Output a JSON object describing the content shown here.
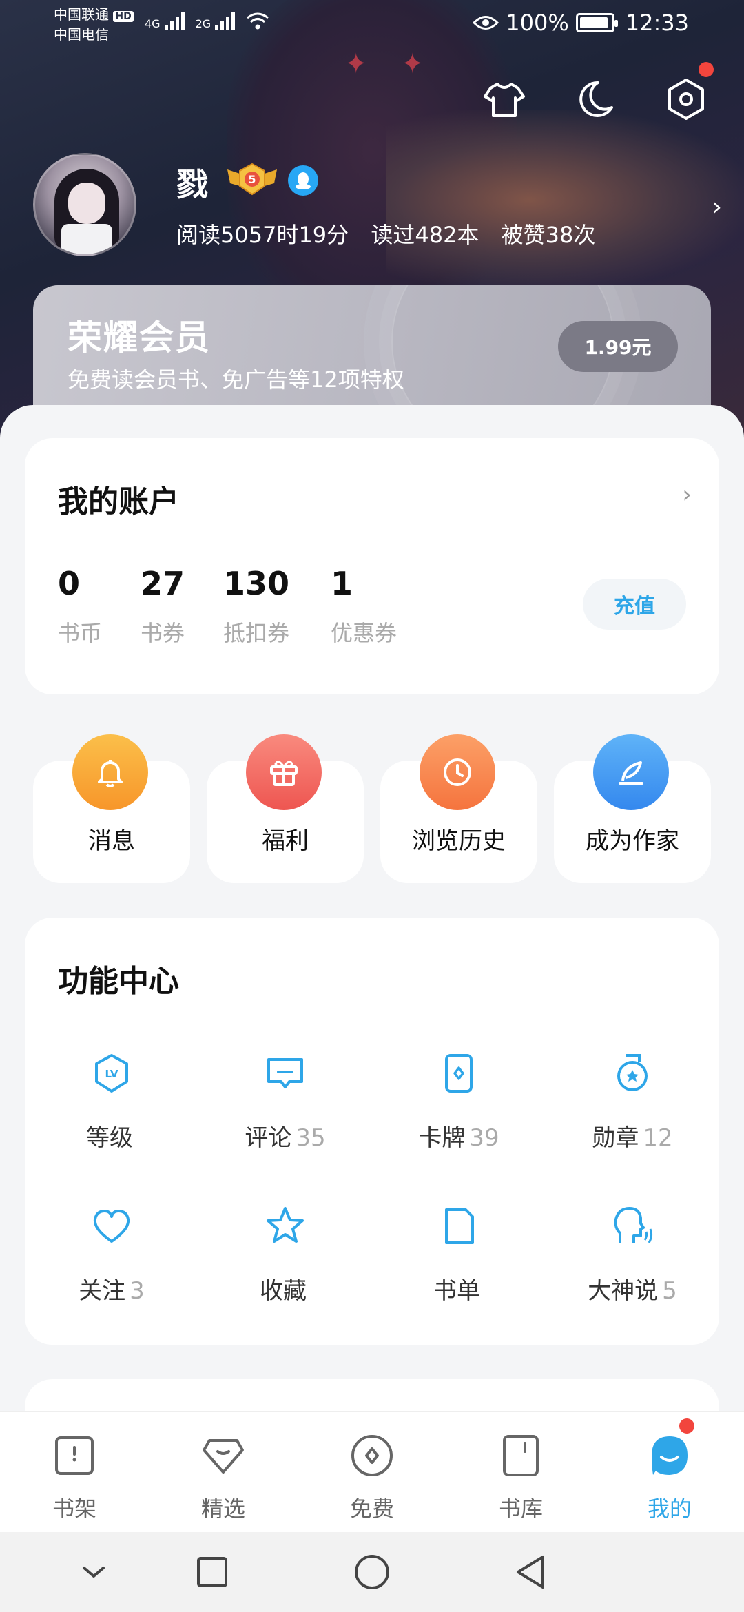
{
  "status_bar": {
    "carrier1": "中国联通",
    "carrier1_badge": "HD",
    "carrier2": "中国电信",
    "net1": "4G",
    "net2": "2G",
    "battery_pct": "100%",
    "time": "12:33"
  },
  "header_icons": [
    "tshirt-icon",
    "moon-icon",
    "settings-hex-icon"
  ],
  "profile": {
    "name": "戮",
    "level": "5",
    "stats": [
      "阅读5057时19分",
      "读过482本",
      "被赞38次"
    ]
  },
  "vip": {
    "title": "荣耀会员",
    "subtitle": "免费读会员书、免广告等12项特权",
    "price_button": "1.99元"
  },
  "account": {
    "title": "我的账户",
    "items": [
      {
        "value": "0",
        "label": "书币"
      },
      {
        "value": "27",
        "label": "书券"
      },
      {
        "value": "130",
        "label": "抵扣券"
      },
      {
        "value": "1",
        "label": "优惠券"
      }
    ],
    "recharge": "充值"
  },
  "quick_tiles": [
    {
      "label": "消息",
      "icon": "bell-icon",
      "color": "#f9a83a"
    },
    {
      "label": "福利",
      "icon": "gift-icon",
      "color": "#f26a64"
    },
    {
      "label": "浏览历史",
      "icon": "clock-icon",
      "color": "#f98455"
    },
    {
      "label": "成为作家",
      "icon": "quill-icon",
      "color": "#3d9cf2"
    }
  ],
  "features": {
    "title": "功能中心",
    "items": [
      {
        "label": "等级",
        "count": "",
        "icon": "level-hex-icon"
      },
      {
        "label": "评论",
        "count": "35",
        "icon": "comment-icon"
      },
      {
        "label": "卡牌",
        "count": "39",
        "icon": "card-icon"
      },
      {
        "label": "勋章",
        "count": "12",
        "icon": "medal-icon"
      },
      {
        "label": "关注",
        "count": "3",
        "icon": "heart-icon"
      },
      {
        "label": "收藏",
        "count": "",
        "icon": "star-icon"
      },
      {
        "label": "书单",
        "count": "",
        "icon": "doc-icon"
      },
      {
        "label": "大神说",
        "count": "5",
        "icon": "speaking-head-icon"
      }
    ]
  },
  "bottom_nav": [
    {
      "label": "书架",
      "icon": "bookshelf-icon",
      "active": false
    },
    {
      "label": "精选",
      "icon": "featured-icon",
      "active": false
    },
    {
      "label": "免费",
      "icon": "free-icon",
      "active": false
    },
    {
      "label": "书库",
      "icon": "library-icon",
      "active": false
    },
    {
      "label": "我的",
      "icon": "profile-mascot-icon",
      "active": true
    }
  ],
  "colors": {
    "accent": "#2ea6e8",
    "red_dot": "#f2453d"
  }
}
